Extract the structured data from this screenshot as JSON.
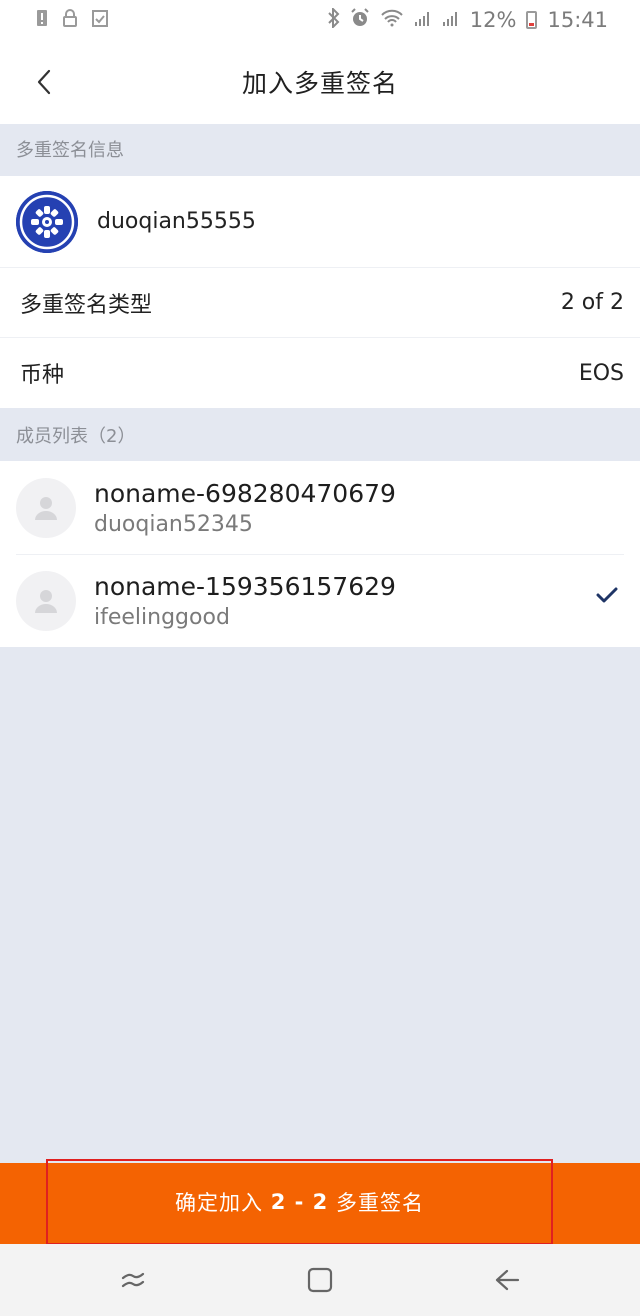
{
  "status_bar": {
    "battery_percent": "12%",
    "time": "15:41"
  },
  "nav": {
    "title": "加入多重签名"
  },
  "multisig_info": {
    "section_title": "多重签名信息",
    "account_name": "duoqian55555",
    "type_label": "多重签名类型",
    "type_value": "2 of 2",
    "currency_label": "币种",
    "currency_value": "EOS"
  },
  "members": {
    "section_title": "成员列表（2）",
    "items": [
      {
        "name": "noname-698280470679",
        "account": "duoqian52345",
        "checked": false
      },
      {
        "name": "noname-159356157629",
        "account": "ifeelinggood",
        "checked": true
      }
    ]
  },
  "confirm": {
    "label_prefix": "确定加入 ",
    "label_bold": "2 - 2",
    "label_suffix": " 多重签名"
  },
  "colors": {
    "accent": "#f46302",
    "check": "#1f3566",
    "logo": "#2541b2"
  }
}
